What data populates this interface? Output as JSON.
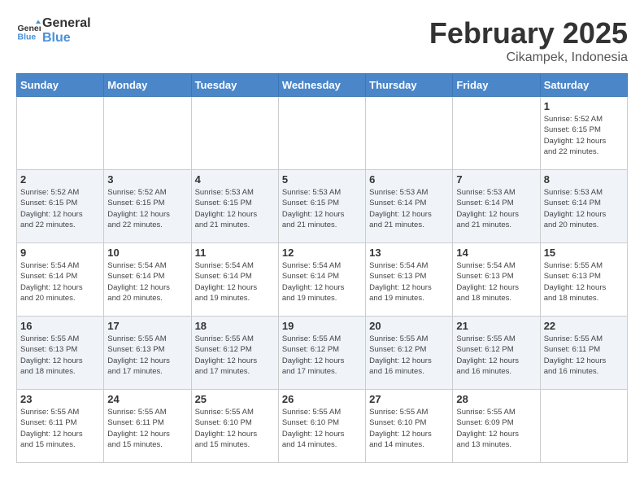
{
  "header": {
    "logo_line1": "General",
    "logo_line2": "Blue",
    "month_year": "February 2025",
    "location": "Cikampek, Indonesia"
  },
  "days_of_week": [
    "Sunday",
    "Monday",
    "Tuesday",
    "Wednesday",
    "Thursday",
    "Friday",
    "Saturday"
  ],
  "weeks": [
    [
      {
        "day": "",
        "info": ""
      },
      {
        "day": "",
        "info": ""
      },
      {
        "day": "",
        "info": ""
      },
      {
        "day": "",
        "info": ""
      },
      {
        "day": "",
        "info": ""
      },
      {
        "day": "",
        "info": ""
      },
      {
        "day": "1",
        "info": "Sunrise: 5:52 AM\nSunset: 6:15 PM\nDaylight: 12 hours\nand 22 minutes."
      }
    ],
    [
      {
        "day": "2",
        "info": "Sunrise: 5:52 AM\nSunset: 6:15 PM\nDaylight: 12 hours\nand 22 minutes."
      },
      {
        "day": "3",
        "info": "Sunrise: 5:52 AM\nSunset: 6:15 PM\nDaylight: 12 hours\nand 22 minutes."
      },
      {
        "day": "4",
        "info": "Sunrise: 5:53 AM\nSunset: 6:15 PM\nDaylight: 12 hours\nand 21 minutes."
      },
      {
        "day": "5",
        "info": "Sunrise: 5:53 AM\nSunset: 6:15 PM\nDaylight: 12 hours\nand 21 minutes."
      },
      {
        "day": "6",
        "info": "Sunrise: 5:53 AM\nSunset: 6:14 PM\nDaylight: 12 hours\nand 21 minutes."
      },
      {
        "day": "7",
        "info": "Sunrise: 5:53 AM\nSunset: 6:14 PM\nDaylight: 12 hours\nand 21 minutes."
      },
      {
        "day": "8",
        "info": "Sunrise: 5:53 AM\nSunset: 6:14 PM\nDaylight: 12 hours\nand 20 minutes."
      }
    ],
    [
      {
        "day": "9",
        "info": "Sunrise: 5:54 AM\nSunset: 6:14 PM\nDaylight: 12 hours\nand 20 minutes."
      },
      {
        "day": "10",
        "info": "Sunrise: 5:54 AM\nSunset: 6:14 PM\nDaylight: 12 hours\nand 20 minutes."
      },
      {
        "day": "11",
        "info": "Sunrise: 5:54 AM\nSunset: 6:14 PM\nDaylight: 12 hours\nand 19 minutes."
      },
      {
        "day": "12",
        "info": "Sunrise: 5:54 AM\nSunset: 6:14 PM\nDaylight: 12 hours\nand 19 minutes."
      },
      {
        "day": "13",
        "info": "Sunrise: 5:54 AM\nSunset: 6:13 PM\nDaylight: 12 hours\nand 19 minutes."
      },
      {
        "day": "14",
        "info": "Sunrise: 5:54 AM\nSunset: 6:13 PM\nDaylight: 12 hours\nand 18 minutes."
      },
      {
        "day": "15",
        "info": "Sunrise: 5:55 AM\nSunset: 6:13 PM\nDaylight: 12 hours\nand 18 minutes."
      }
    ],
    [
      {
        "day": "16",
        "info": "Sunrise: 5:55 AM\nSunset: 6:13 PM\nDaylight: 12 hours\nand 18 minutes."
      },
      {
        "day": "17",
        "info": "Sunrise: 5:55 AM\nSunset: 6:13 PM\nDaylight: 12 hours\nand 17 minutes."
      },
      {
        "day": "18",
        "info": "Sunrise: 5:55 AM\nSunset: 6:12 PM\nDaylight: 12 hours\nand 17 minutes."
      },
      {
        "day": "19",
        "info": "Sunrise: 5:55 AM\nSunset: 6:12 PM\nDaylight: 12 hours\nand 17 minutes."
      },
      {
        "day": "20",
        "info": "Sunrise: 5:55 AM\nSunset: 6:12 PM\nDaylight: 12 hours\nand 16 minutes."
      },
      {
        "day": "21",
        "info": "Sunrise: 5:55 AM\nSunset: 6:12 PM\nDaylight: 12 hours\nand 16 minutes."
      },
      {
        "day": "22",
        "info": "Sunrise: 5:55 AM\nSunset: 6:11 PM\nDaylight: 12 hours\nand 16 minutes."
      }
    ],
    [
      {
        "day": "23",
        "info": "Sunrise: 5:55 AM\nSunset: 6:11 PM\nDaylight: 12 hours\nand 15 minutes."
      },
      {
        "day": "24",
        "info": "Sunrise: 5:55 AM\nSunset: 6:11 PM\nDaylight: 12 hours\nand 15 minutes."
      },
      {
        "day": "25",
        "info": "Sunrise: 5:55 AM\nSunset: 6:10 PM\nDaylight: 12 hours\nand 15 minutes."
      },
      {
        "day": "26",
        "info": "Sunrise: 5:55 AM\nSunset: 6:10 PM\nDaylight: 12 hours\nand 14 minutes."
      },
      {
        "day": "27",
        "info": "Sunrise: 5:55 AM\nSunset: 6:10 PM\nDaylight: 12 hours\nand 14 minutes."
      },
      {
        "day": "28",
        "info": "Sunrise: 5:55 AM\nSunset: 6:09 PM\nDaylight: 12 hours\nand 13 minutes."
      },
      {
        "day": "",
        "info": ""
      }
    ]
  ]
}
